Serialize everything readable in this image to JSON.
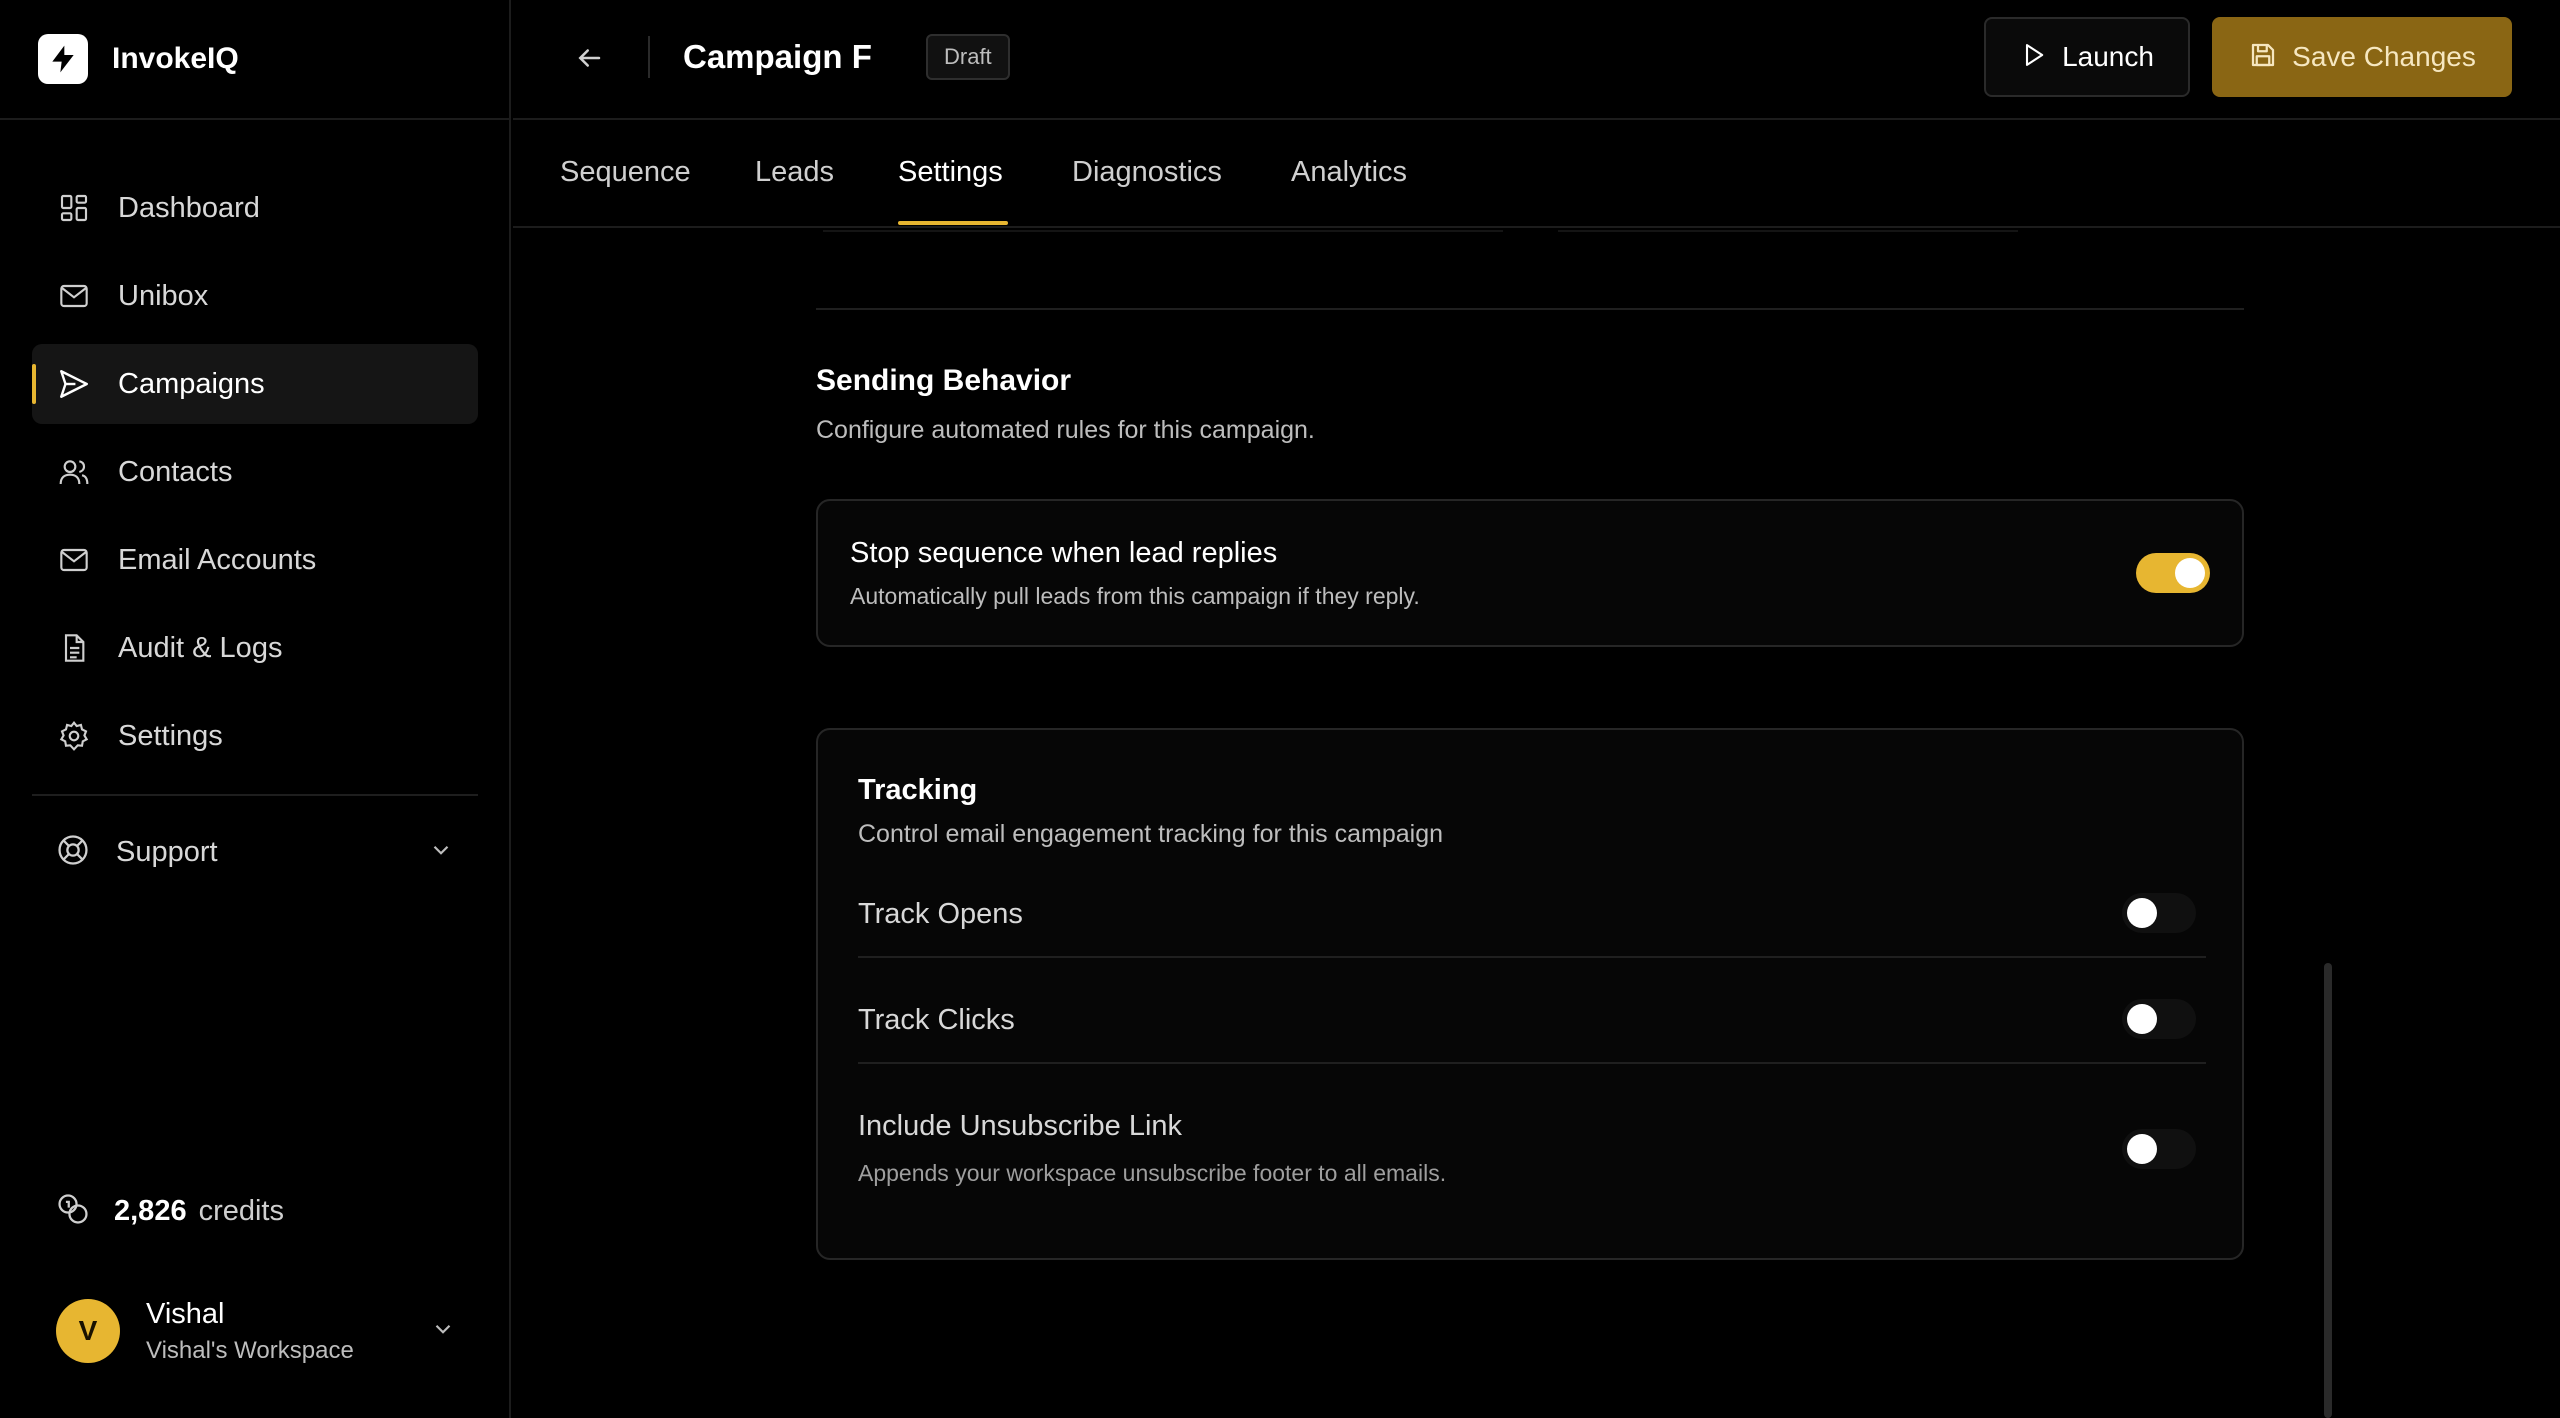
{
  "brand": {
    "name": "InvokeIQ",
    "accent": "#e7b631"
  },
  "sidebar": {
    "items": [
      {
        "label": "Dashboard",
        "icon": "grid-icon"
      },
      {
        "label": "Unibox",
        "icon": "mail-icon"
      },
      {
        "label": "Campaigns",
        "icon": "send-icon",
        "active": true
      },
      {
        "label": "Contacts",
        "icon": "users-icon"
      },
      {
        "label": "Email Accounts",
        "icon": "mail-icon"
      },
      {
        "label": "Audit & Logs",
        "icon": "file-icon"
      },
      {
        "label": "Settings",
        "icon": "gear-icon"
      }
    ],
    "support_label": "Support",
    "credits": {
      "value": "2,826",
      "unit": "credits"
    },
    "user": {
      "initial": "V",
      "name": "Vishal",
      "workspace": "Vishal's Workspace"
    }
  },
  "header": {
    "title": "Campaign F",
    "status_badge": "Draft",
    "launch_label": "Launch",
    "save_label": "Save Changes"
  },
  "tabs": [
    {
      "label": "Sequence"
    },
    {
      "label": "Leads"
    },
    {
      "label": "Settings",
      "active": true
    },
    {
      "label": "Diagnostics"
    },
    {
      "label": "Analytics"
    }
  ],
  "sending_behavior": {
    "title": "Sending Behavior",
    "description": "Configure automated rules for this campaign.",
    "stop_on_reply": {
      "title": "Stop sequence when lead replies",
      "description": "Automatically pull leads from this campaign if they reply.",
      "enabled": true
    }
  },
  "tracking": {
    "title": "Tracking",
    "description": "Control email engagement tracking for this campaign",
    "options": [
      {
        "label": "Track Opens",
        "enabled": false
      },
      {
        "label": "Track Clicks",
        "enabled": false
      },
      {
        "label": "Include Unsubscribe Link",
        "sub": "Appends your workspace unsubscribe footer to all emails.",
        "enabled": false
      }
    ]
  }
}
